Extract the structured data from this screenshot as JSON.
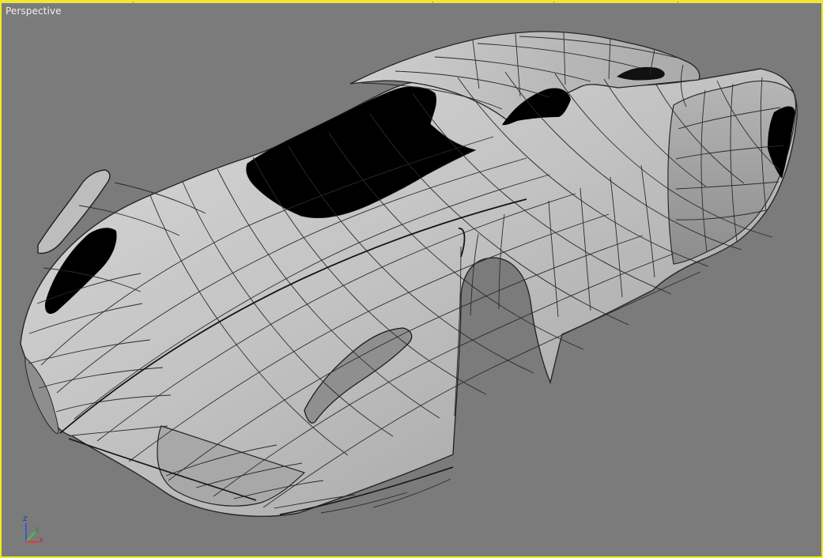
{
  "viewport": {
    "label": "Perspective",
    "accent_color": "#f2ea1a",
    "background_color": "#7b7b7b"
  },
  "gizmo": {
    "axes": [
      "z",
      "y",
      "x"
    ],
    "colors": {
      "x": "#e03a3a",
      "y": "#48c548",
      "z": "#3a58d8"
    }
  },
  "model": {
    "type": "car-body-wireframe",
    "shading": "gray-smooth-with-edged-faces"
  }
}
